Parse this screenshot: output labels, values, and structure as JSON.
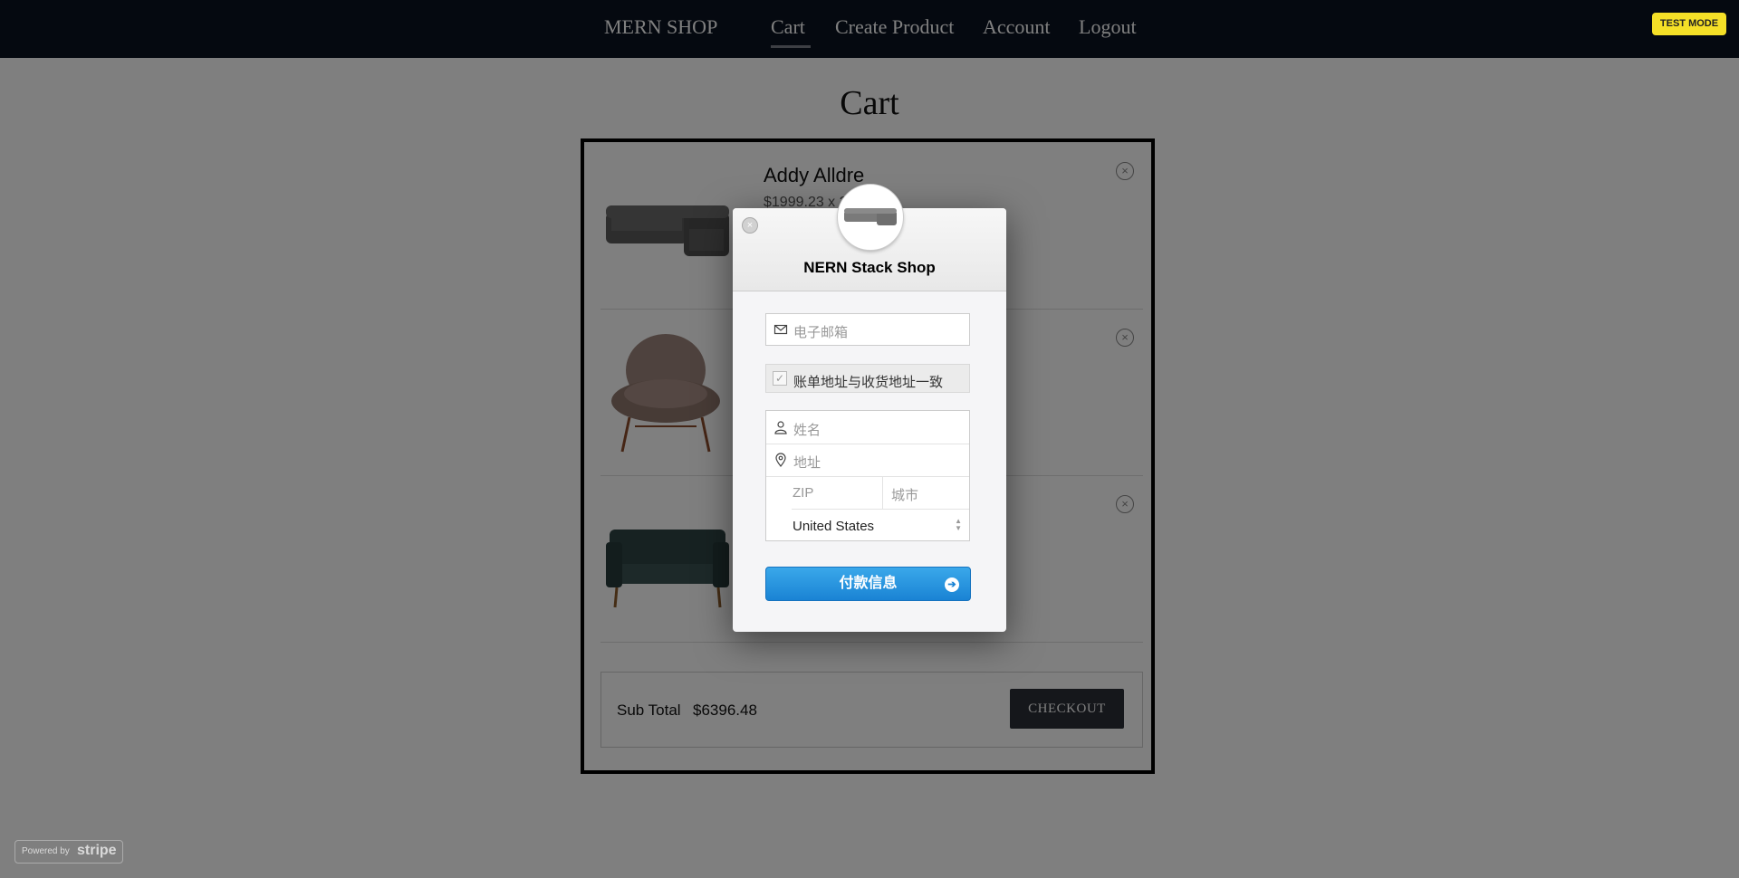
{
  "nav": {
    "brand": "MERN SHOP",
    "links": [
      {
        "label": "Cart",
        "active": true
      },
      {
        "label": "Create Product"
      },
      {
        "label": "Account"
      },
      {
        "label": "Logout"
      }
    ]
  },
  "page": {
    "title": "Cart"
  },
  "cart": {
    "items": [
      {
        "name": "Addy Alldre",
        "price": "$1999.23 x 2",
        "remove_icon": "circle-x-icon"
      },
      {
        "remove_icon": "circle-x-icon"
      },
      {
        "remove_icon": "circle-x-icon"
      }
    ],
    "subtotal_label": "Sub Total",
    "subtotal_amount": "$6396.48",
    "checkout_label": "CHECKOUT"
  },
  "stripe": {
    "test_mode": "TEST MODE",
    "powered_by": "Powered by",
    "powered_brand": "stripe",
    "shop_name": "NERN Stack Shop",
    "email_placeholder": "电子邮箱",
    "same_address_label": "账单地址与收货地址一致",
    "same_address_checked": true,
    "name_placeholder": "姓名",
    "address_placeholder": "地址",
    "zip_placeholder": "ZIP",
    "city_placeholder": "城市",
    "country": "United States",
    "pay_button_label": "付款信息",
    "accent_color": "#1a83d4",
    "test_mode_color": "#f5e027"
  }
}
